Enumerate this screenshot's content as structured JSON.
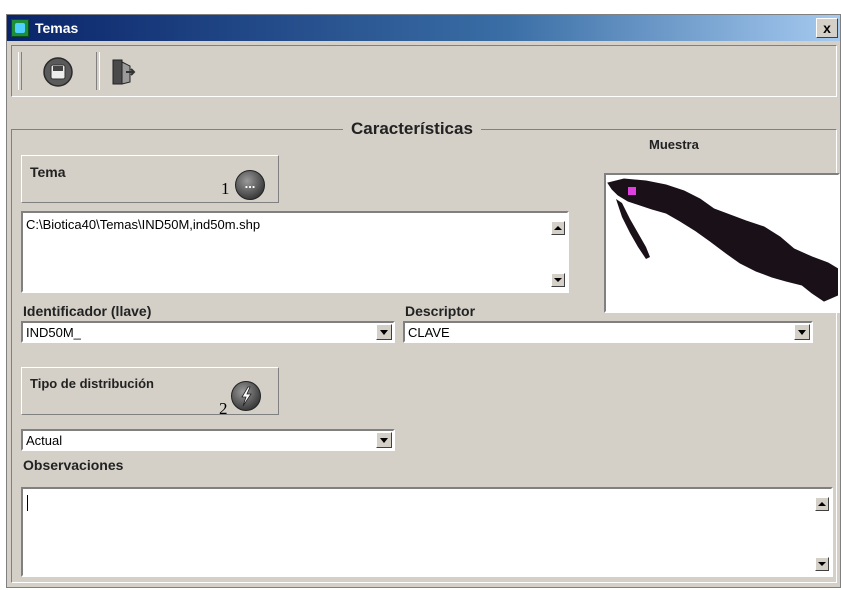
{
  "window": {
    "title": "Temas",
    "close_glyph": "x"
  },
  "toolbar": {
    "save_icon": "save-disk-icon",
    "exit_icon": "exit-door-icon"
  },
  "group": {
    "title": "Características"
  },
  "tema": {
    "label": "Tema",
    "step_number": "1",
    "browse_glyph": "...",
    "path_value": "C:\\Biotica40\\Temas\\IND50M,ind50m.shp"
  },
  "muestra": {
    "label": "Muestra",
    "highlight_color": "#e040e0",
    "map_color": "#1a1018"
  },
  "identificador": {
    "label": "Identificador (llave)",
    "value": "IND50M_"
  },
  "descriptor": {
    "label": "Descriptor",
    "value": "CLAVE"
  },
  "distribucion": {
    "label": "Tipo de distribución",
    "step_number": "2",
    "button_icon": "lightning-icon",
    "value": "Actual"
  },
  "observaciones": {
    "label": "Observaciones",
    "value": ""
  }
}
